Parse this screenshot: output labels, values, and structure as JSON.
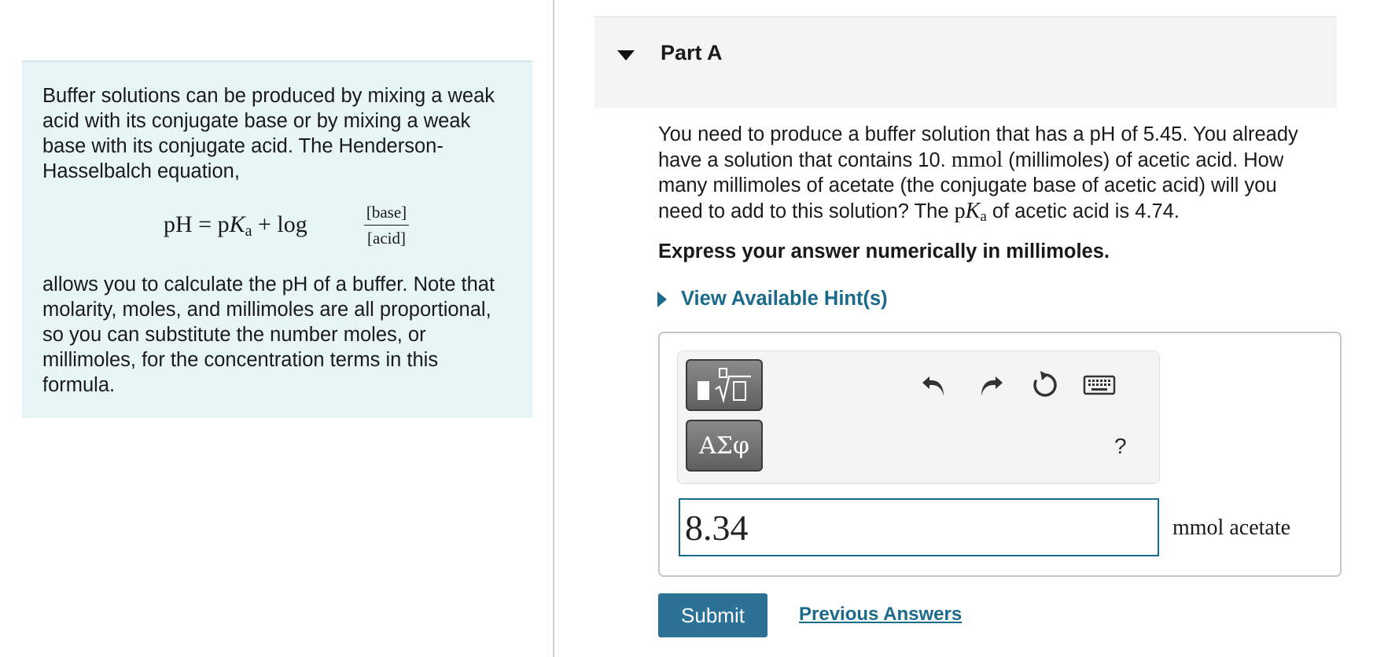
{
  "intro": {
    "paragraph1": "Buffer solutions can be produced by mixing a weak acid with its conjugate base or by mixing a weak base with its conjugate acid. The Henderson-Hasselbalch equation,",
    "paragraph2": "allows you to calculate the pH of a buffer. Note that molarity, moles, and millimoles are all proportional, so you can substitute the number moles, or millimoles, for the concentration terms in this formula."
  },
  "equation": {
    "lhs": "pH = p",
    "K": "K",
    "sub": "a",
    "log": " + log ",
    "numerator": "[base]",
    "denominator": "[acid]"
  },
  "part": {
    "title": "Part A"
  },
  "question": {
    "text_a": "You need to produce a buffer solution that has a pH of 5.45. You already have a solution that contains 10. ",
    "unit_mmol": "mmol",
    "text_b": " (millimoles) of acetic acid. How many millimoles of acetate (the conjugate base of acetic acid) will you need to add to this solution? The ",
    "pK_p": "p",
    "pK_K": "K",
    "pK_sub": "a",
    "text_c": " of acetic acid is 4.74.",
    "instruction": "Express your answer numerically in millimoles."
  },
  "hint": {
    "label": "View Available Hint(s)"
  },
  "toolbar": {
    "greek_label": "ΑΣφ",
    "help_label": "?",
    "icons": [
      "templates-icon",
      "greek-letters-icon",
      "undo-icon",
      "redo-icon",
      "reset-icon",
      "keyboard-icon",
      "help-icon"
    ]
  },
  "answer": {
    "value": "8.34",
    "unit": "mmol acetate"
  },
  "actions": {
    "submit_label": "Submit",
    "previous_answers_label": "Previous Answers"
  },
  "colors": {
    "accent": "#1b6a8c",
    "submit_bg": "#2c7196",
    "intro_bg": "#e8f5f6"
  }
}
